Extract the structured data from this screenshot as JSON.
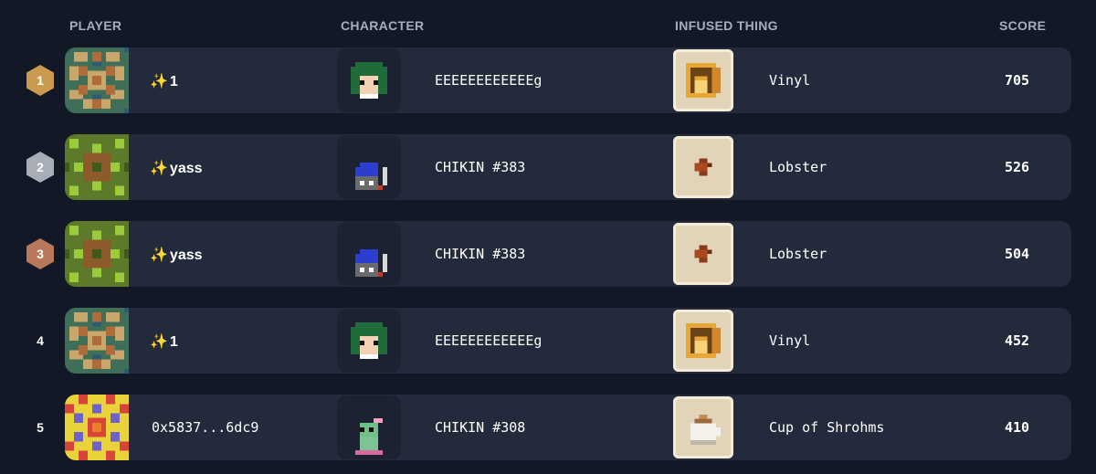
{
  "headers": {
    "player": "PLAYER",
    "character": "CHARACTER",
    "infused": "INFUSED THING",
    "score": "SCORE"
  },
  "colors": {
    "background": "#121826",
    "row": "#232a3b",
    "gold": "#c99a50",
    "silver": "#a8adb7",
    "bronze": "#b9785a",
    "sparkle": "#ff5a6e"
  },
  "rows": [
    {
      "rank": "1",
      "player": "1",
      "player_sparkle": "✨",
      "character": "EEEEEEEEEEEEg",
      "thing": "Vinyl",
      "score": "705"
    },
    {
      "rank": "2",
      "player": "yass",
      "player_sparkle": "✨",
      "character": "CHIKIN #383",
      "thing": "Lobster",
      "score": "526"
    },
    {
      "rank": "3",
      "player": "yass",
      "player_sparkle": "✨",
      "character": "CHIKIN #383",
      "thing": "Lobster",
      "score": "504"
    },
    {
      "rank": "4",
      "player": "1",
      "player_sparkle": "✨",
      "character": "EEEEEEEEEEEEg",
      "thing": "Vinyl",
      "score": "452"
    },
    {
      "rank": "5",
      "player": "0x5837...6dc9",
      "player_sparkle": "",
      "character": "CHIKIN #308",
      "thing": "Cup of Shrohms",
      "score": "410"
    }
  ]
}
